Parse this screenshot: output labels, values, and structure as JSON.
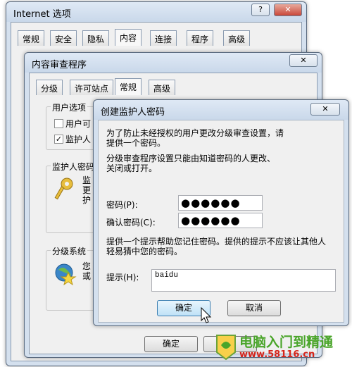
{
  "internet_options": {
    "title": "Internet 选项",
    "help": "?",
    "tabs": [
      "常规",
      "安全",
      "隐私",
      "内容",
      "连接",
      "程序",
      "高级"
    ]
  },
  "content_advisor": {
    "title": "内容审查程序",
    "close": "✕",
    "tabs": [
      "分级",
      "许可站点",
      "常规",
      "高级"
    ],
    "user_options_label": "用户选项",
    "option1": "用户可",
    "option2": "监护人",
    "supervisor_label": "监护人密码",
    "supervisor_text": [
      "监",
      "更",
      "护"
    ],
    "ratings_label": "分级系统",
    "ratings_text": [
      "您",
      "或"
    ],
    "ok": "确定"
  },
  "create_password": {
    "title": "创建监护人密码",
    "close": "✕",
    "intro": "为了防止未经授权的用户更改分级审查设置，请提供一个密码。",
    "info": "分级审查程序设置只能由知道密码的人更改、关闭或打开。",
    "password_label": "密码(P):",
    "password_value": "●●●●●●",
    "confirm_label": "确认密码(C):",
    "confirm_value": "●●●●●●",
    "hint_info": "提供一个提示帮助您记住密码。提供的提示不应该让其他人轻易猜中您的密码。",
    "hint_label": "提示(H):",
    "hint_value": "baidu",
    "ok": "确定",
    "cancel": "取消"
  },
  "watermark": {
    "line1": "电脑入门到精通",
    "line2": "www.58116.cn"
  }
}
